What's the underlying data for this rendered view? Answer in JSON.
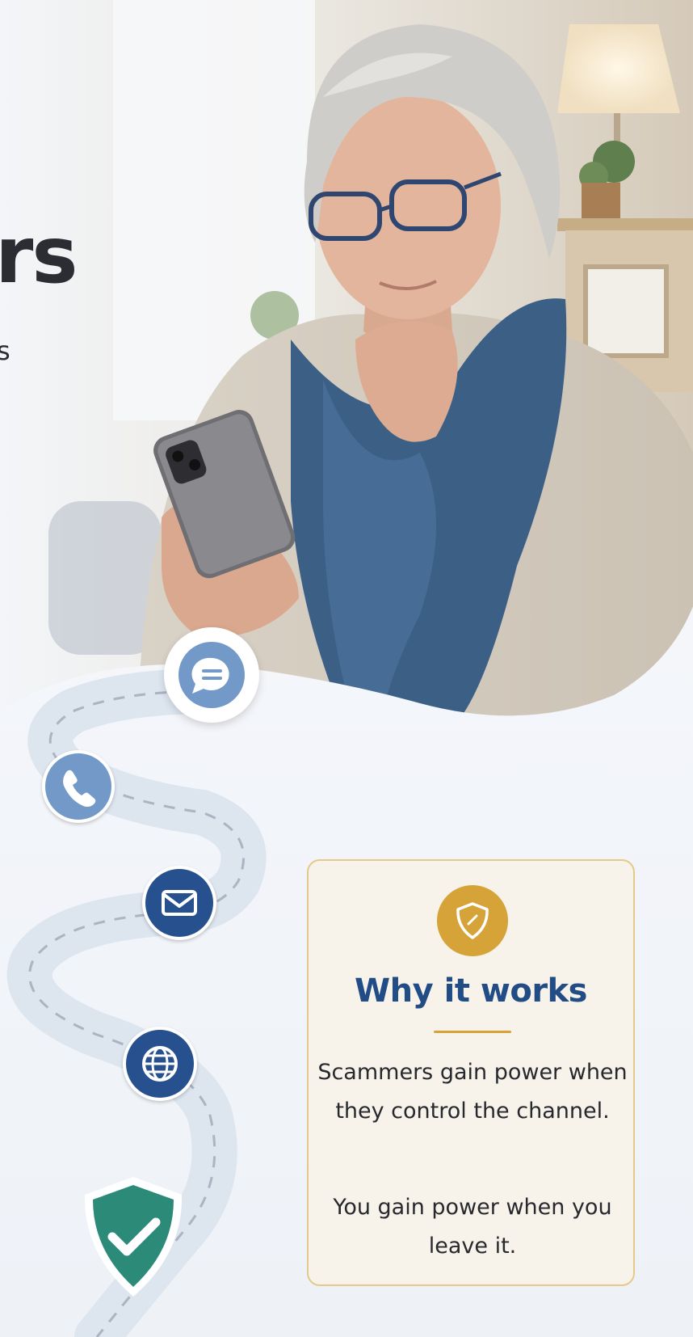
{
  "headline_fragment": "rs",
  "subline_fragment": "s",
  "card": {
    "title": "Why it works",
    "text_1": "Scammers gain power when they control the channel.",
    "text_2": "You gain power when you leave it."
  },
  "colors": {
    "title_blue": "#214c86",
    "gold_accent": "#d6a338",
    "card_bg": "#f8f3ea",
    "node_light_blue": "#7399c8",
    "node_dark_blue": "#27508f",
    "shield_green": "#2b8a78"
  },
  "icons": [
    "chat-bubble-icon",
    "phone-icon",
    "mail-icon",
    "globe-icon",
    "shield-check-icon",
    "shield-icon"
  ]
}
